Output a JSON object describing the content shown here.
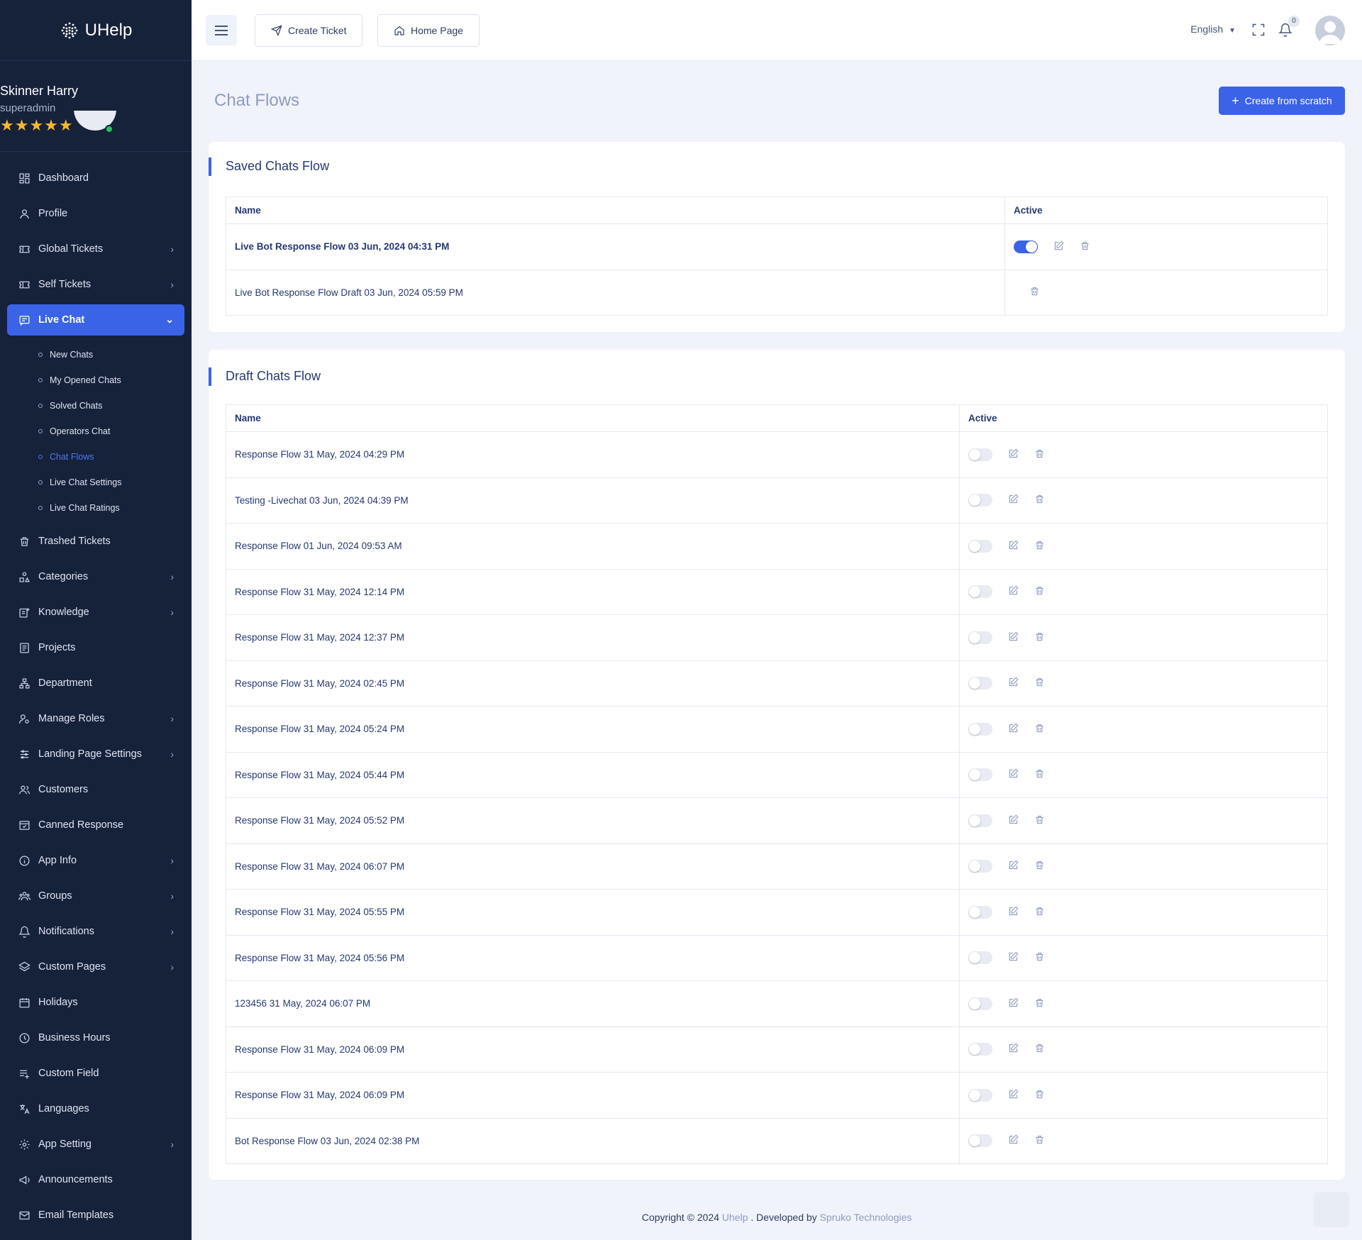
{
  "brand": {
    "name": "UHelp"
  },
  "profile": {
    "name": "Skinner Harry",
    "role": "superadmin",
    "stars": "★★★★★"
  },
  "sidebar": {
    "items_before": [
      {
        "label": "Dashboard",
        "icon": "dashboard-icon",
        "chev": ""
      },
      {
        "label": "Profile",
        "icon": "user-icon",
        "chev": ""
      },
      {
        "label": "Global Tickets",
        "icon": "ticket-icon",
        "chev": "›"
      },
      {
        "label": "Self Tickets",
        "icon": "ticket-icon",
        "chev": "›"
      }
    ],
    "active": {
      "label": "Live Chat",
      "icon": "chat-icon",
      "chev": "⌄"
    },
    "sub_items": [
      {
        "label": "New Chats"
      },
      {
        "label": "My Opened Chats"
      },
      {
        "label": "Solved Chats"
      },
      {
        "label": "Operators Chat"
      },
      {
        "label": "Chat Flows"
      },
      {
        "label": "Live Chat Settings"
      },
      {
        "label": "Live Chat Ratings"
      }
    ],
    "items_after": [
      {
        "label": "Trashed Tickets",
        "icon": "trash-icon",
        "chev": ""
      },
      {
        "label": "Categories",
        "icon": "categories-icon",
        "chev": "›"
      },
      {
        "label": "Knowledge",
        "icon": "knowledge-icon",
        "chev": "›"
      },
      {
        "label": "Projects",
        "icon": "projects-icon",
        "chev": ""
      },
      {
        "label": "Department",
        "icon": "department-icon",
        "chev": ""
      },
      {
        "label": "Manage Roles",
        "icon": "roles-icon",
        "chev": "›"
      },
      {
        "label": "Landing Page Settings",
        "icon": "sliders-icon",
        "chev": "›"
      },
      {
        "label": "Customers",
        "icon": "customers-icon",
        "chev": ""
      },
      {
        "label": "Canned Response",
        "icon": "canned-icon",
        "chev": ""
      },
      {
        "label": "App Info",
        "icon": "info-icon",
        "chev": "›"
      },
      {
        "label": "Groups",
        "icon": "groups-icon",
        "chev": "›"
      },
      {
        "label": "Notifications",
        "icon": "bell-icon",
        "chev": "›"
      },
      {
        "label": "Custom Pages",
        "icon": "layers-icon",
        "chev": "›"
      },
      {
        "label": "Holidays",
        "icon": "calendar-icon",
        "chev": ""
      },
      {
        "label": "Business Hours",
        "icon": "clock-icon",
        "chev": ""
      },
      {
        "label": "Custom Field",
        "icon": "field-icon",
        "chev": ""
      },
      {
        "label": "Languages",
        "icon": "translate-icon",
        "chev": ""
      },
      {
        "label": "App Setting",
        "icon": "gear-icon",
        "chev": "›"
      },
      {
        "label": "Announcements",
        "icon": "megaphone-icon",
        "chev": ""
      },
      {
        "label": "Email Templates",
        "icon": "mail-icon",
        "chev": ""
      }
    ]
  },
  "header": {
    "create_ticket": "Create Ticket",
    "home_page": "Home Page",
    "language": "English",
    "notif_count": "0"
  },
  "page": {
    "title": "Chat Flows",
    "create_button": "Create from scratch"
  },
  "saved": {
    "title": "Saved Chats Flow",
    "col_name": "Name",
    "col_active": "Active",
    "rows": [
      {
        "name": "Live Bot Response Flow 03 Jun, 2024 04:31 PM",
        "active": true,
        "bold": true
      },
      {
        "name": "Live Bot Response Flow Draft 03 Jun, 2024 05:59 PM",
        "active": null,
        "bold": false
      }
    ]
  },
  "draft": {
    "title": "Draft Chats Flow",
    "col_name": "Name",
    "col_active": "Active",
    "rows": [
      {
        "name": "Response Flow 31 May, 2024 04:29 PM"
      },
      {
        "name": "Testing -Livechat 03 Jun, 2024 04:39 PM"
      },
      {
        "name": "Response Flow 01 Jun, 2024 09:53 AM"
      },
      {
        "name": "Response Flow 31 May, 2024 12:14 PM"
      },
      {
        "name": "Response Flow 31 May, 2024 12:37 PM"
      },
      {
        "name": "Response Flow 31 May, 2024 02:45 PM"
      },
      {
        "name": "Response Flow 31 May, 2024 05:24 PM"
      },
      {
        "name": "Response Flow 31 May, 2024 05:44 PM"
      },
      {
        "name": "Response Flow 31 May, 2024 05:52 PM"
      },
      {
        "name": "Response Flow 31 May, 2024 06:07 PM"
      },
      {
        "name": "Response Flow 31 May, 2024 05:55 PM"
      },
      {
        "name": "Response Flow 31 May, 2024 05:56 PM"
      },
      {
        "name": "123456 31 May, 2024 06:07 PM"
      },
      {
        "name": "Response Flow 31 May, 2024 06:09 PM"
      },
      {
        "name": "Response Flow 31 May, 2024 06:09 PM"
      },
      {
        "name": "Bot Response Flow 03 Jun, 2024 02:38 PM"
      }
    ]
  },
  "footer": {
    "prefix": "Copyright © 2024 ",
    "brand_link": "Uhelp",
    "middle": " . Developed by ",
    "dev_link": "Spruko Technologies"
  },
  "colors": {
    "primary": "#3b63e8",
    "sidebar_bg": "#16213a",
    "page_bg": "#f0f3fa"
  }
}
